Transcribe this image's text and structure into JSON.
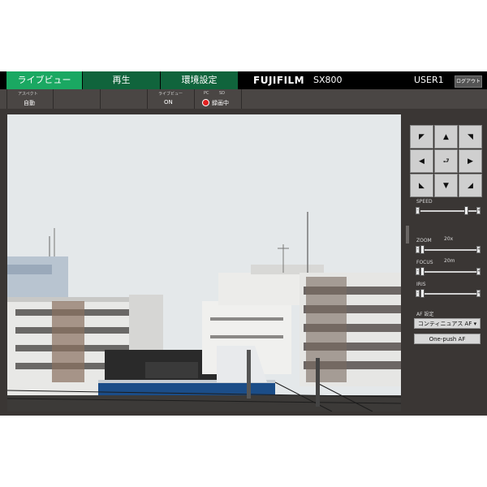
{
  "tabs": [
    {
      "label": "ライブビュー",
      "active": true
    },
    {
      "label": "再生",
      "active": false
    },
    {
      "label": "環境設定",
      "active": false
    }
  ],
  "brand": "FUJIFILM",
  "model": "SX800",
  "user": "USER1",
  "logout_label": "ログアウト",
  "status": {
    "aspect_label": "アスペクト",
    "aspect_value": "自動",
    "liveview_label": "ライブビュー",
    "liveview_value": "ON",
    "pc_label": "PC",
    "sd_label": "SD",
    "recording_label": "録画中"
  },
  "controls": {
    "speed_label": "SPEED",
    "zoom_label": "ZOOM",
    "zoom_value": "20x",
    "focus_label": "FOCUS",
    "focus_value": "20m",
    "iris_label": "IRIS",
    "af_label": "AF 設定",
    "af_mode": "コンティニュアス AF ▾",
    "one_push_label": "One-push AF",
    "minus": "-",
    "plus": "+",
    "speed_level": 0.85,
    "zoom_level": 0.0,
    "focus_level": 0.0,
    "iris_level": 0.0
  },
  "ptz_icons": [
    "arrow-up-left-icon",
    "arrow-up-icon",
    "arrow-up-right-icon",
    "arrow-left-icon",
    "home-return-icon",
    "arrow-right-icon",
    "arrow-down-left-icon",
    "arrow-down-icon",
    "arrow-down-right-icon"
  ],
  "colors": {
    "tab_active": "#1aa862",
    "tab_inactive": "#10643c",
    "rec": "#e02020"
  }
}
